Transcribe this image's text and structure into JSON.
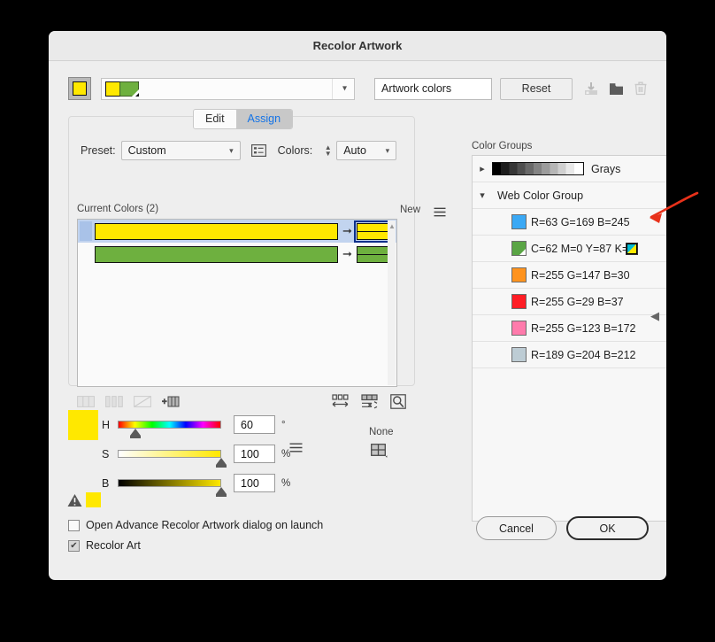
{
  "window": {
    "title": "Recolor Artwork"
  },
  "toolbar": {
    "artwork_swatch_icon": "artwork-color-swatch",
    "combo_icon": "artwork-thumbnail",
    "combo_chevron_icon": "chevron-down-icon",
    "colors_field_value": "Artwork colors",
    "colors_field_placeholder": "Artwork colors",
    "reset_label": "Reset",
    "save_icon": "save-color-group-icon",
    "folder_icon": "new-color-group-icon",
    "delete_icon": "trash-icon"
  },
  "tabs": [
    {
      "label": "Edit",
      "active": false
    },
    {
      "label": "Assign",
      "active": true
    }
  ],
  "assign_panel": {
    "preset_label": "Preset:",
    "preset_value": "Custom",
    "preset_options_icon": "preset-options-icon",
    "colors_label": "Colors:",
    "colors_value": "Auto",
    "colors_stepper_icon": "stepper-updown-icon",
    "current_colors_label": "Current Colors (2)",
    "new_label": "New",
    "menu_icon": "panel-menu-icon",
    "rows": [
      {
        "current_color": "#ffe800",
        "new_color": "#ffe800",
        "arrow_icon": "assign-arrow-icon",
        "selected": true
      },
      {
        "current_color": "#6eb03f",
        "new_color": "#6eb03f",
        "arrow_icon": "assign-arrow-icon",
        "selected": false
      }
    ],
    "tools_left": [
      {
        "icon": "merge-colors-icon",
        "enabled": false
      },
      {
        "icon": "separate-colors-icon",
        "enabled": false
      },
      {
        "icon": "exclude-colors-icon",
        "enabled": false
      },
      {
        "icon": "add-color-row-icon",
        "enabled": true
      }
    ],
    "tools_right": [
      {
        "icon": "randomize-order-icon",
        "enabled": true
      },
      {
        "icon": "randomize-saturation-brightness-icon",
        "enabled": true
      },
      {
        "icon": "color-reduction-options-icon",
        "enabled": true
      }
    ]
  },
  "sliders": {
    "preview_swatch": "#ffe800",
    "warning_icon": "out-of-gamut-warning-icon",
    "warning_swatch": "#ffe800",
    "rows": [
      {
        "label": "H",
        "value": "60",
        "unit": "°",
        "thumb_pct": 17
      },
      {
        "label": "S",
        "value": "100",
        "unit": "%",
        "thumb_pct": 100
      },
      {
        "label": "B",
        "value": "100",
        "unit": "%",
        "thumb_pct": 100
      }
    ],
    "menu_icon": "color-mode-menu-icon",
    "none_label": "None",
    "grid_icon": "color-swatch-grid-icon"
  },
  "color_groups": {
    "label": "Color Groups",
    "grays": {
      "disclosure_icon": "chevron-right-icon",
      "swatch_icon": "grays-gradient-swatch",
      "name": "Grays"
    },
    "web_group": {
      "disclosure_icon": "chevron-down-icon",
      "name": "Web Color Group"
    },
    "items": [
      {
        "swatch": "#3ba9f5",
        "text": "R=63 G=169 B=245",
        "mode": "rgb",
        "indicator_icon": "rgb-mode-icon"
      },
      {
        "swatch": "#5aa545",
        "text": "C=62 M=0 Y=87 K=0",
        "mode": "cmyk",
        "indicator_icon": "cmyk-mode-icon"
      },
      {
        "swatch": "#ff931e",
        "text": "R=255 G=147 B=30",
        "mode": "rgb",
        "indicator_icon": "rgb-mode-icon"
      },
      {
        "swatch": "#ff1d25",
        "text": "R=255 G=29 B=37",
        "mode": "rgb",
        "indicator_icon": "rgb-mode-icon"
      },
      {
        "swatch": "#ff7bac",
        "text": "R=255 G=123 B=172",
        "mode": "rgb",
        "indicator_icon": "rgb-mode-icon"
      },
      {
        "swatch": "#bdccd4",
        "text": "R=189 G=204 B=212",
        "mode": "rgb",
        "indicator_icon": "rgb-mode-icon"
      }
    ],
    "collapse_icon": "collapse-panel-arrow-icon"
  },
  "annotation": {
    "arrow_icon": "red-pointer-arrow",
    "color": "#e8311a"
  },
  "footer": {
    "checkbox_launch_label": "Open Advance Recolor Artwork dialog on launch",
    "checkbox_launch_checked": false,
    "checkbox_recolor_label": "Recolor Art",
    "checkbox_recolor_checked": true,
    "checkbox_check_glyph": "✔",
    "cancel_label": "Cancel",
    "ok_label": "OK"
  }
}
